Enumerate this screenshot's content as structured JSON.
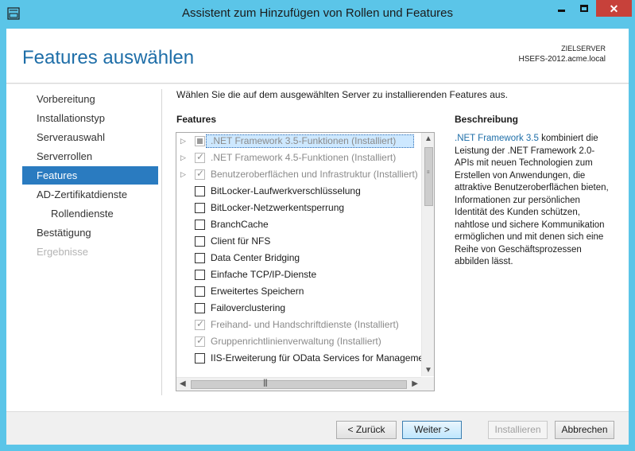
{
  "window": {
    "title": "Assistent zum Hinzufügen von Rollen und Features"
  },
  "header": {
    "page_title": "Features auswählen",
    "server_label": "ZIELSERVER",
    "server_name": "HSEFS-2012.acme.local"
  },
  "nav": {
    "items": [
      {
        "label": "Vorbereitung",
        "state": "normal"
      },
      {
        "label": "Installationstyp",
        "state": "normal"
      },
      {
        "label": "Serverauswahl",
        "state": "normal"
      },
      {
        "label": "Serverrollen",
        "state": "normal"
      },
      {
        "label": "Features",
        "state": "active"
      },
      {
        "label": "AD-Zertifikatdienste",
        "state": "normal"
      },
      {
        "label": "Rollendienste",
        "state": "sub"
      },
      {
        "label": "Bestätigung",
        "state": "normal"
      },
      {
        "label": "Ergebnisse",
        "state": "disabled"
      }
    ]
  },
  "main": {
    "instruction": "Wählen Sie die auf dem ausgewählten Server zu installierenden Features aus.",
    "features_heading": "Features",
    "features": [
      {
        "label": ".NET Framework 3.5-Funktionen (Installiert)",
        "expandable": true,
        "check": "partial",
        "installed": true,
        "selected": true
      },
      {
        "label": ".NET Framework 4.5-Funktionen (Installiert)",
        "expandable": true,
        "check": "checked",
        "installed": true
      },
      {
        "label": "Benutzeroberflächen und Infrastruktur (Installiert)",
        "expandable": true,
        "check": "checked",
        "installed": true
      },
      {
        "label": "BitLocker-Laufwerkverschlüsselung",
        "check": "none"
      },
      {
        "label": "BitLocker-Netzwerkentsperrung",
        "check": "none"
      },
      {
        "label": "BranchCache",
        "check": "none"
      },
      {
        "label": "Client für NFS",
        "check": "none"
      },
      {
        "label": "Data Center Bridging",
        "check": "none"
      },
      {
        "label": "Einfache TCP/IP-Dienste",
        "check": "none"
      },
      {
        "label": "Erweitertes Speichern",
        "check": "none"
      },
      {
        "label": "Failoverclustering",
        "check": "none"
      },
      {
        "label": "Freihand- und Handschriftdienste (Installiert)",
        "check": "checked",
        "installed": true
      },
      {
        "label": "Gruppenrichtlinienverwaltung (Installiert)",
        "check": "checked",
        "installed": true
      },
      {
        "label": "IIS-Erweiterung für OData Services for Manageme",
        "check": "none"
      }
    ],
    "description_heading": "Beschreibung",
    "description_link": ".NET Framework 3.5",
    "description_body": " kombiniert die Leistung der .NET Framework 2.0-APIs mit neuen Technologien zum Erstellen von Anwendungen, die attraktive Benutzeroberflächen bieten, Informationen zur persönlichen Identität des Kunden schützen, nahtlose und sichere Kommunikation ermöglichen und mit denen sich eine Reihe von Geschäftsprozessen abbilden lässt."
  },
  "footer": {
    "back": "< Zurück",
    "next": "Weiter >",
    "install": "Installieren",
    "cancel": "Abbrechen"
  },
  "icons": {
    "app": "server-manager-icon",
    "expand": "triangle-right-icon",
    "scroll_up": "arrow-up-icon",
    "scroll_down": "arrow-down-icon",
    "scroll_left": "arrow-left-icon",
    "scroll_right": "arrow-right-icon"
  },
  "colors": {
    "title_bar": "#5bc5e8",
    "close_button": "#c7413a",
    "accent": "#2a7bc0",
    "title_text": "#1e6ea8"
  }
}
